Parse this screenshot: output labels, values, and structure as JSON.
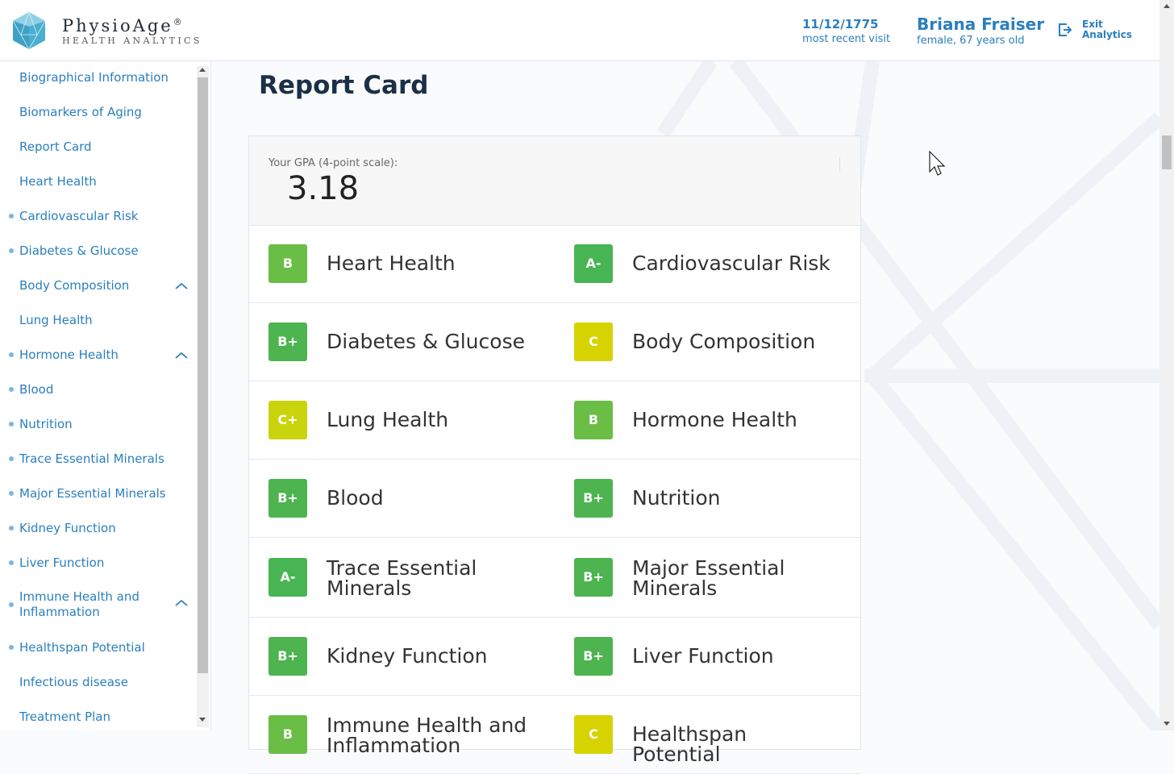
{
  "header": {
    "brand_name": "PhysioAge",
    "brand_registered": "®",
    "brand_sub": "HEALTH ANALYTICS",
    "visit_date": "11/12/1775",
    "visit_label": "most recent visit",
    "patient_name": "Briana Fraiser",
    "patient_sub": "female, 67 years old",
    "exit_label": "Exit Analytics"
  },
  "sidebar": {
    "items": [
      {
        "label": "Biographical Information",
        "dot": false,
        "chevron": false
      },
      {
        "label": "Biomarkers of Aging",
        "dot": false,
        "chevron": false
      },
      {
        "label": "Report Card",
        "dot": false,
        "chevron": false
      },
      {
        "label": "Heart Health",
        "dot": false,
        "chevron": false
      },
      {
        "label": "Cardiovascular Risk",
        "dot": true,
        "chevron": false
      },
      {
        "label": "Diabetes & Glucose",
        "dot": true,
        "chevron": false
      },
      {
        "label": "Body Composition",
        "dot": false,
        "chevron": true
      },
      {
        "label": "Lung Health",
        "dot": false,
        "chevron": false
      },
      {
        "label": "Hormone Health",
        "dot": true,
        "chevron": true
      },
      {
        "label": "Blood",
        "dot": true,
        "chevron": false
      },
      {
        "label": "Nutrition",
        "dot": true,
        "chevron": false
      },
      {
        "label": "Trace Essential Minerals",
        "dot": true,
        "chevron": false
      },
      {
        "label": "Major Essential Minerals",
        "dot": true,
        "chevron": false
      },
      {
        "label": "Kidney Function",
        "dot": true,
        "chevron": false
      },
      {
        "label": "Liver Function",
        "dot": true,
        "chevron": false
      },
      {
        "label": "Immune Health and Inflammation",
        "dot": true,
        "chevron": true
      },
      {
        "label": "Healthspan Potential",
        "dot": true,
        "chevron": false
      },
      {
        "label": "Infectious disease",
        "dot": false,
        "chevron": false
      },
      {
        "label": "Treatment Plan",
        "dot": false,
        "chevron": false
      }
    ]
  },
  "main": {
    "title": "Report Card",
    "gpa_label": "Your GPA (4-point scale):",
    "gpa_value": "3.18",
    "grades": [
      {
        "grade": "B",
        "category": "Heart Health",
        "color": "#6abd45"
      },
      {
        "grade": "A-",
        "category": "Cardiovascular Risk",
        "color": "#47b553"
      },
      {
        "grade": "B+",
        "category": "Diabetes & Glucose",
        "color": "#4db44f"
      },
      {
        "grade": "C",
        "category": "Body Composition",
        "color": "#d7d300"
      },
      {
        "grade": "C+",
        "category": "Lung Health",
        "color": "#c9d40c"
      },
      {
        "grade": "B",
        "category": "Hormone Health",
        "color": "#6abd45"
      },
      {
        "grade": "B+",
        "category": "Blood",
        "color": "#4db44f"
      },
      {
        "grade": "B+",
        "category": "Nutrition",
        "color": "#4db44f"
      },
      {
        "grade": "A-",
        "category": "Trace Essential Minerals",
        "color": "#47b553"
      },
      {
        "grade": "B+",
        "category": "Major Essential Minerals",
        "color": "#4db44f"
      },
      {
        "grade": "B+",
        "category": "Kidney Function",
        "color": "#4db44f"
      },
      {
        "grade": "B+",
        "category": "Liver Function",
        "color": "#4db44f"
      },
      {
        "grade": "B",
        "category": "Immune Health and Inflammation",
        "color": "#6abd45"
      },
      {
        "grade": "C",
        "category": "Healthspan Potential",
        "color": "#d7d300"
      }
    ]
  }
}
